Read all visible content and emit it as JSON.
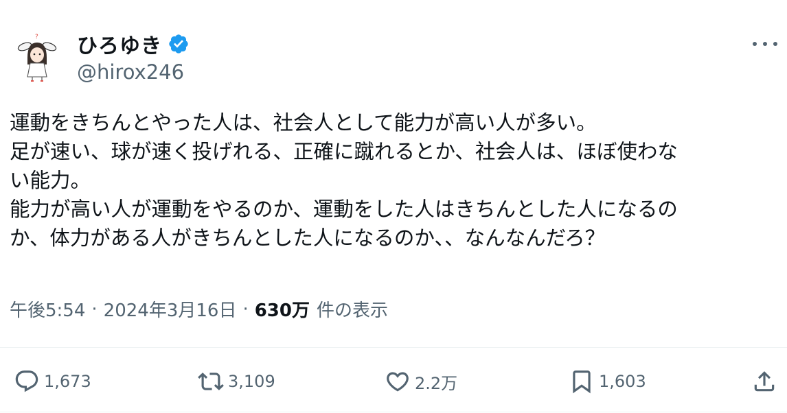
{
  "author": {
    "display_name": "ひろゆき",
    "handle": "@hirox246",
    "verified": true,
    "verified_color": "#1d9bf0"
  },
  "tweet": {
    "lines": [
      "運動をきちんとやった人は、社会人として能力が高い人が多い。",
      "足が速い、球が速く投げれる、正確に蹴れるとか、社会人は、ほぼ使わな",
      "い能力。",
      "能力が高い人が運動をやるのか、運動をした人はきちんとした人になるの",
      "か、体力がある人がきちんとした人になるのか、、なんなんだろ？"
    ]
  },
  "meta": {
    "time": "午後5:54",
    "separator": "·",
    "date": "2024年3月16日",
    "views_count": "630万",
    "views_label": "件の表示"
  },
  "actions": {
    "reply_count": "1,673",
    "retweet_count": "3,109",
    "like_count": "2.2万",
    "bookmark_count": "1,603"
  },
  "icons": {
    "reply": "speech-bubble-icon",
    "retweet": "retweet-arrows-icon",
    "like": "heart-icon",
    "bookmark": "bookmark-icon",
    "share": "share-upload-icon",
    "more": "more-dots-icon"
  },
  "colors": {
    "text": "#0f1419",
    "secondary": "#536471",
    "divider": "#eff3f4"
  }
}
